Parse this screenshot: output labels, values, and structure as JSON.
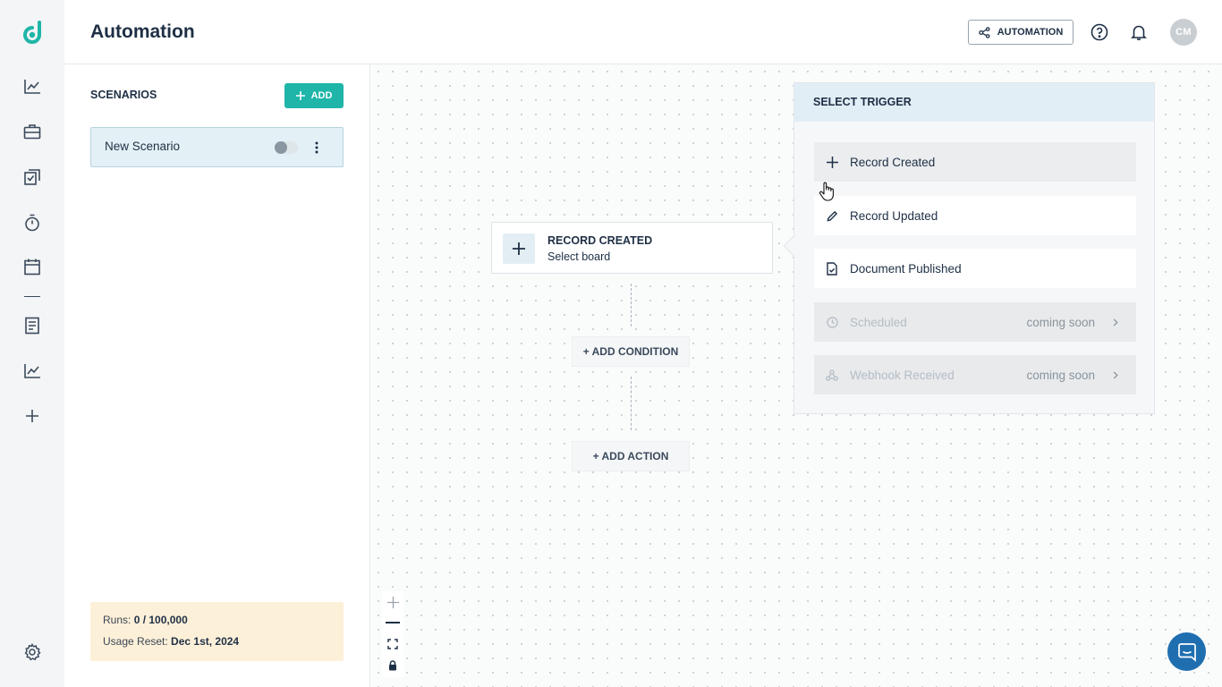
{
  "colors": {
    "accent": "#1fb5a8",
    "brand_logo": "#1fb5a8",
    "chat_button": "#1f6fb0",
    "usage_bg": "#fdf0d8",
    "selected_scenario_bg": "#e3f0f5"
  },
  "sidebar": {
    "logo": "d",
    "icons": [
      "dashboard-chart-icon",
      "briefcase-icon",
      "tasks-check-icon",
      "timer-icon",
      "calendar-icon",
      "document-icon",
      "reports-chart-icon",
      "plus-icon",
      "settings-gear-icon"
    ]
  },
  "header": {
    "title": "Automation",
    "automation_button": "AUTOMATION",
    "avatar_initials": "CM"
  },
  "scenarios": {
    "title": "SCENARIOS",
    "add_label": "ADD",
    "items": [
      {
        "name": "New Scenario",
        "enabled": false
      }
    ]
  },
  "usage": {
    "runs_label": "Runs:",
    "runs_value": "0 / 100,000",
    "reset_label": "Usage Reset:",
    "reset_value": "Dec 1st, 2024"
  },
  "canvas": {
    "trigger_node": {
      "title": "RECORD CREATED",
      "subtitle": "Select board"
    },
    "add_condition": "+ ADD CONDITION",
    "add_action": "+ ADD ACTION"
  },
  "trigger_popup": {
    "title": "SELECT TRIGGER",
    "options": [
      {
        "label": "Record Created",
        "icon": "plus-icon",
        "state": "hover"
      },
      {
        "label": "Record Updated",
        "icon": "pencil-icon",
        "state": "normal"
      },
      {
        "label": "Document Published",
        "icon": "document-check-icon",
        "state": "normal"
      },
      {
        "label": "Scheduled",
        "icon": "clock-icon",
        "state": "disabled",
        "badge": "coming soon"
      },
      {
        "label": "Webhook Received",
        "icon": "webhook-icon",
        "state": "disabled",
        "badge": "coming soon"
      }
    ]
  }
}
